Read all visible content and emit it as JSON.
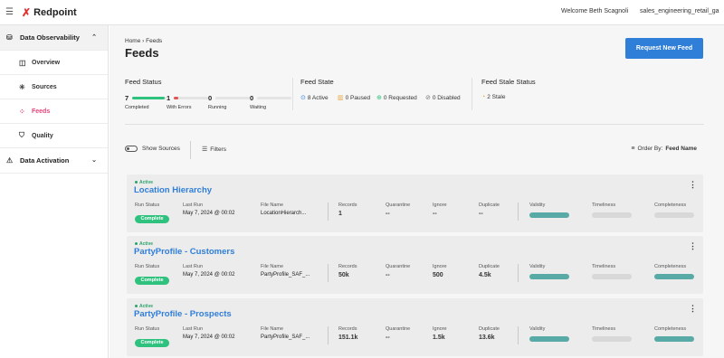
{
  "app": {
    "name": "Redpoint",
    "welcome": "Welcome Beth Scagnoli",
    "account": "sales_engineering_retail_ga"
  },
  "sidebar": {
    "group1": "Data Observability",
    "items": [
      {
        "label": "Overview",
        "icon": "overview-icon"
      },
      {
        "label": "Sources",
        "icon": "sources-icon"
      },
      {
        "label": "Feeds",
        "icon": "feeds-icon"
      },
      {
        "label": "Quality",
        "icon": "quality-icon"
      }
    ],
    "group2": "Data Activation"
  },
  "header": {
    "breadcrumb": "Home  ›  Feeds",
    "title": "Feeds",
    "request_button": "Request New Feed"
  },
  "feed_status": {
    "title": "Feed Status",
    "items": [
      {
        "value": "7",
        "label": "Completed",
        "color": "#2ec27e",
        "fill": 0.95
      },
      {
        "value": "1",
        "label": "With Errors",
        "color": "#e05454",
        "fill": 0.12
      },
      {
        "value": "0",
        "label": "Running",
        "color": "#9b9b9b",
        "fill": 0
      },
      {
        "value": "0",
        "label": "Waiting",
        "color": "#9b9b9b",
        "fill": 0
      }
    ]
  },
  "feed_state": {
    "title": "Feed State",
    "items": [
      {
        "label": "8 Active",
        "icon": "check-circle-icon"
      },
      {
        "label": "0 Paused",
        "icon": "pause-icon"
      },
      {
        "label": "0 Requested",
        "icon": "plus-circle-icon"
      },
      {
        "label": "0 Disabled",
        "icon": "disabled-icon"
      }
    ]
  },
  "feed_stale": {
    "title": "Feed Stale Status",
    "items": [
      {
        "label": "2 Stale",
        "icon": "stale-icon"
      }
    ]
  },
  "filters": {
    "show_sources": "Show Sources",
    "filters": "Filters",
    "order_by_label": "Order By:",
    "order_by_value": "Feed Name"
  },
  "columns": {
    "run_status": "Run Status",
    "last_run": "Last Run",
    "file_name": "File Name",
    "records": "Records",
    "quarantine": "Quarantine",
    "ignore": "Ignore",
    "duplicate": "Duplicate",
    "validity": "Validity",
    "timeliness": "Timeliness",
    "completeness": "Completeness"
  },
  "feeds": [
    {
      "state": "Active",
      "name": "Location Hierarchy",
      "run_status": "Complete",
      "last_run": "May 7, 2024 @ 00:02",
      "file_name": "LocationHierarch...",
      "records": "1",
      "quarantine": "--",
      "ignore": "--",
      "duplicate": "--",
      "validity_ok": true,
      "timeliness_ok": false,
      "completeness_ok": false
    },
    {
      "state": "Active",
      "name": "PartyProfile - Customers",
      "run_status": "Complete",
      "last_run": "May 7, 2024 @ 00:02",
      "file_name": "PartyProfile_SAF_...",
      "records": "50k",
      "quarantine": "--",
      "ignore": "500",
      "duplicate": "4.5k",
      "validity_ok": true,
      "timeliness_ok": false,
      "completeness_ok": true
    },
    {
      "state": "Active",
      "name": "PartyProfile - Prospects",
      "run_status": "Complete",
      "last_run": "May 7, 2024 @ 00:02",
      "file_name": "PartyProfile_SAF_...",
      "records": "151.1k",
      "quarantine": "--",
      "ignore": "1.5k",
      "duplicate": "13.6k",
      "validity_ok": true,
      "timeliness_ok": false,
      "completeness_ok": true
    }
  ]
}
